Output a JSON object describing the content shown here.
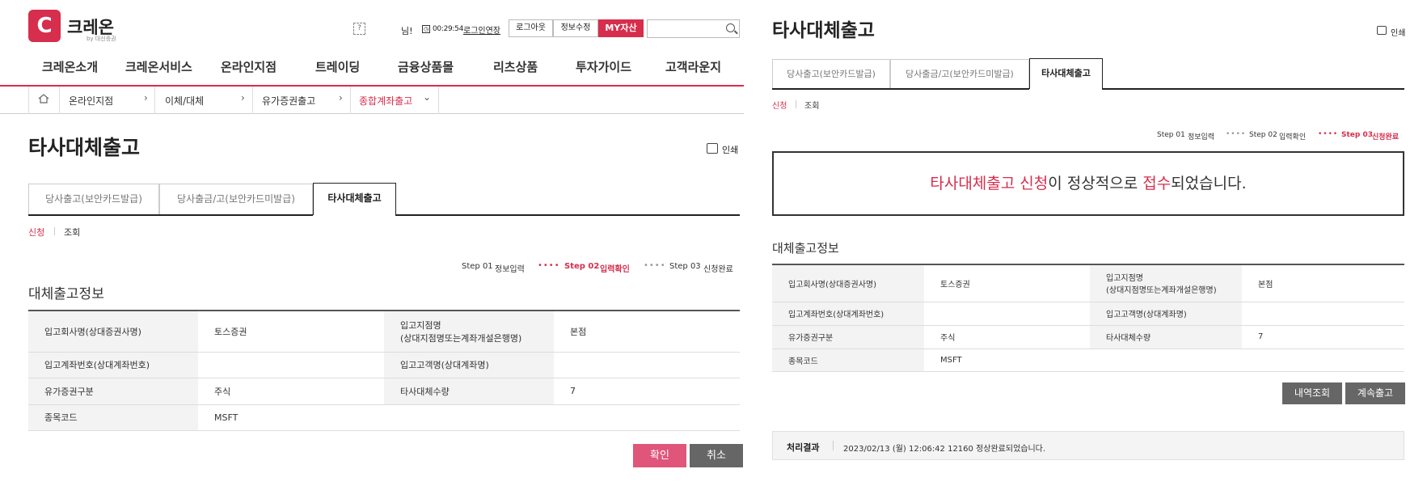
{
  "header": {
    "logo_text": "크레온",
    "logo_mark": "C",
    "logo_sub": "by 대신증권",
    "help_icon": "?",
    "user_suffix": "님!",
    "timer": "00:29:54",
    "extend": "로그인연장",
    "logout": "로그아웃",
    "edit_info": "정보수정",
    "my_assets": "MY자산",
    "search_placeholder": ""
  },
  "gnb": [
    "크레온소개",
    "크레온서비스",
    "온라인지점",
    "트레이딩",
    "금융상품몰",
    "리츠상품",
    "투자가이드",
    "고객라운지"
  ],
  "breadcrumb": [
    "온라인지점",
    "이체/대체",
    "유가증권출고",
    "종합계좌출고"
  ],
  "left": {
    "title": "타사대체출고",
    "print": "인쇄",
    "tabs": [
      "당사출고(보안카드발급)",
      "당사출금/고(보안카드미발급)",
      "타사대체출고"
    ],
    "sub_apply": "신청",
    "sub_query": "조회",
    "steps": {
      "s1_num": "Step 01",
      "s1_label": "정보입력",
      "s2_num": "Step 02",
      "s2_label": "입력확인",
      "s3_num": "Step 03",
      "s3_label": "신청완료",
      "dots": "••••"
    },
    "section_title": "대체출고정보",
    "table": {
      "r1c1": "입고회사명(상대증권사명)",
      "r1c2": "토스증권",
      "r1c3a": "입고지점명",
      "r1c3b": "(상대지점명또는계좌개설은행명)",
      "r1c4": "본점",
      "r2c1": "입고계좌번호(상대계좌번호)",
      "r2c2": "",
      "r2c3": "입고고객명(상대계좌명)",
      "r2c4": "",
      "r3c1": "유가증권구분",
      "r3c2": "주식",
      "r3c3": "타사대체수량",
      "r3c4": "7",
      "r4c1": "종목코드",
      "r4c2": "MSFT"
    },
    "btn_confirm": "확인",
    "btn_cancel": "취소"
  },
  "right": {
    "title": "타사대체출고",
    "print": "인쇄",
    "tabs": [
      "당사출고(보안카드발급)",
      "당사출금/고(보안카드미발급)",
      "타사대체출고"
    ],
    "sub_apply": "신청",
    "sub_query": "조회",
    "done_red1": "타사대체출고 신청",
    "done_mid": "이 정상적으로 ",
    "done_red2": "접수",
    "done_end": "되었습니다.",
    "section_title": "대체출고정보",
    "btn_history": "내역조회",
    "btn_continue": "계속출고",
    "result_label": "처리결과",
    "result_msg": "2023/02/13 (월) 12:06:42 12160 정상완료되었습니다."
  },
  "colors": {
    "accent": "#d62e4c",
    "button_gray": "#666666",
    "confirm_pink": "#e0567a"
  }
}
